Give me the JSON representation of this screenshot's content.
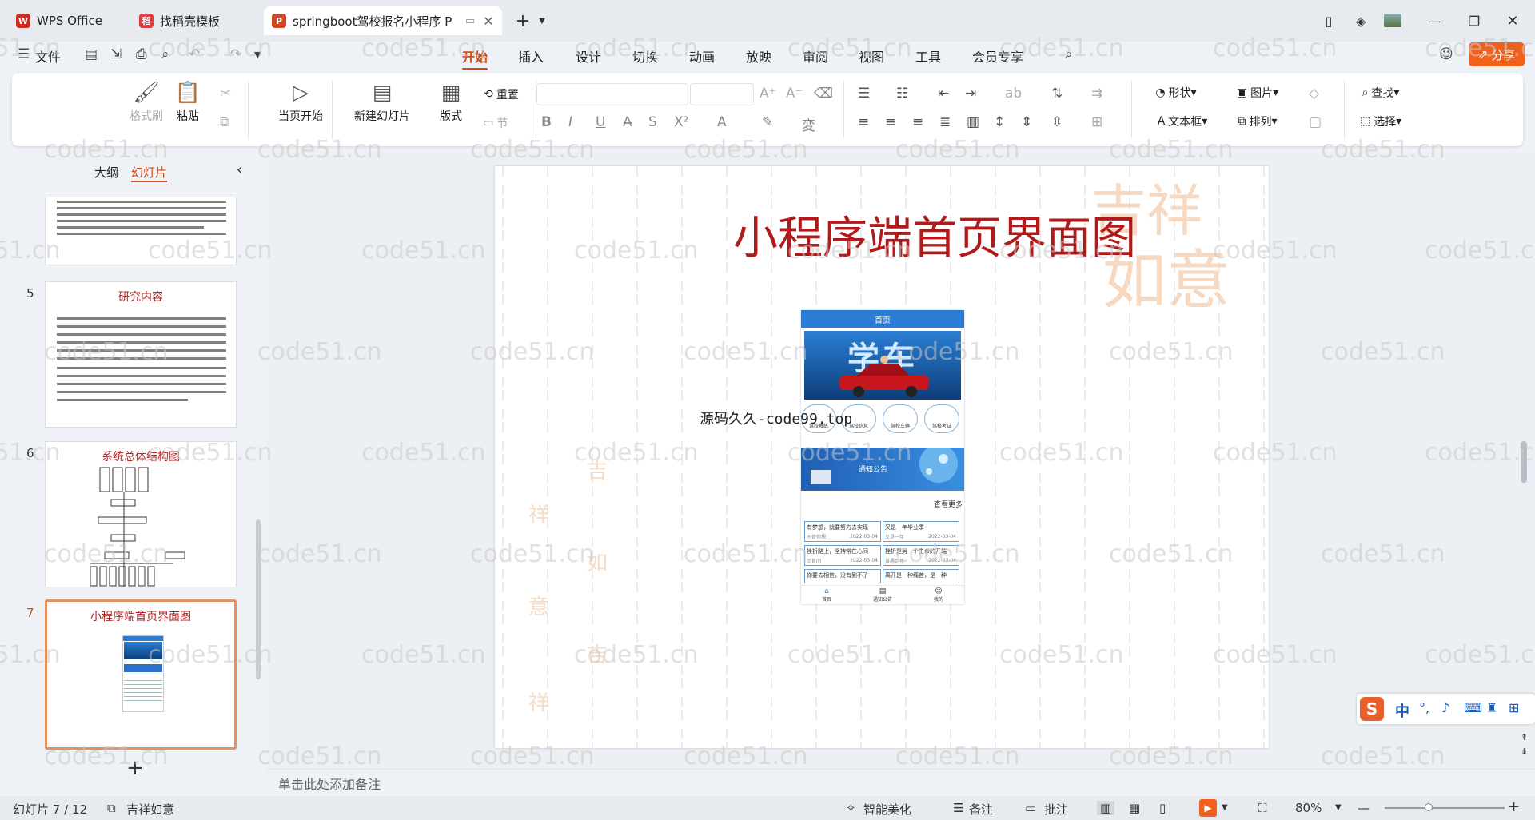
{
  "tabs": [
    {
      "label": "WPS Office",
      "icon": "W",
      "color": "#d2281e"
    },
    {
      "label": "找稻壳模板",
      "icon": "稻",
      "color": "#e0393e"
    },
    {
      "label": "springboot驾校报名小程序 P",
      "icon": "P",
      "color": "#d24726"
    }
  ],
  "menu": {
    "file": "文件",
    "items": [
      "开始",
      "插入",
      "设计",
      "切换",
      "动画",
      "放映",
      "审阅",
      "视图",
      "工具",
      "会员专享"
    ],
    "active": "开始",
    "share": "分享"
  },
  "ribbon": {
    "format_brush": "格式刷",
    "paste": "粘贴",
    "play_from_current": "当页开始",
    "new_slide": "新建幻灯片",
    "layout": "版式",
    "reset": "重置",
    "section": "节",
    "shape": "形状",
    "picture": "图片",
    "find": "查找",
    "textbox": "文本框",
    "arrange": "排列",
    "select": "选择"
  },
  "panel": {
    "outline_tab": "大纲",
    "slides_tab": "幻灯片",
    "add_slide": "+"
  },
  "thumbnails": [
    {
      "num": "5",
      "title": "研究内容"
    },
    {
      "num": "6",
      "title": "系统总体结构图"
    },
    {
      "num": "7",
      "title": "小程序端首页界面图"
    }
  ],
  "slide": {
    "title": "小程序端首页界面图",
    "overlay": "源码久久-code99.top",
    "phone": {
      "header": "首页",
      "hero": "学车",
      "icons": [
        "驾校教练",
        "驾校信息",
        "驾校车辆",
        "驾校考试"
      ],
      "notice": "通知公告",
      "more": "查看更多",
      "cells": [
        {
          "t": "有梦想，就要努力去实现",
          "s": "不管你想",
          "d": "2022-03-04"
        },
        {
          "t": "又是一年毕业季",
          "s": "又是一年",
          "d": "2022-03-04"
        },
        {
          "t": "挫折路上，坚持常在心间",
          "s": "回首间",
          "d": "2022-03-04"
        },
        {
          "t": "挫折是另一个生命的开端",
          "s": "当遇到挫",
          "d": "2022-03-04"
        },
        {
          "t": "你要去相信，没有到不了",
          "s": "",
          "d": ""
        },
        {
          "t": "离开是一种痛苦，是一种",
          "s": "",
          "d": ""
        }
      ],
      "nav": [
        "首页",
        "通知公告",
        "我的"
      ]
    }
  },
  "notes_placeholder": "单击此处添加备注",
  "status": {
    "slide_counter": "幻灯片 7 / 12",
    "theme": "吉祥如意",
    "beautify": "智能美化",
    "notes": "备注",
    "comments": "批注",
    "zoom": "80%"
  },
  "ime": {
    "mode": "中"
  },
  "watermark": "code51.cn"
}
